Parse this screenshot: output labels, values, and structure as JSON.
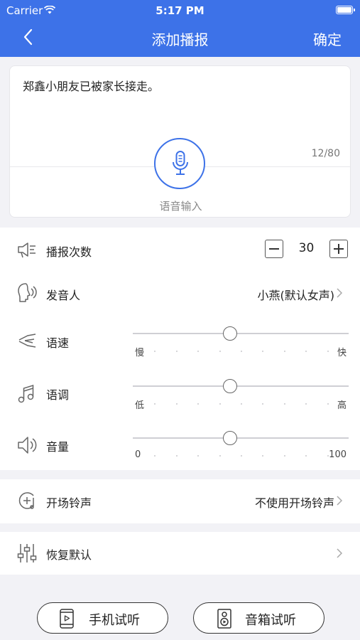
{
  "status": {
    "carrier": "Carrier",
    "time": "5:17 PM"
  },
  "nav": {
    "title": "添加播报",
    "confirm": "确定"
  },
  "text_input": {
    "content": "郑鑫小朋友已被家长接走。",
    "counter": "12/80",
    "voice_label": "语音输入"
  },
  "settings": {
    "play_count": {
      "label": "播报次数",
      "value": "30"
    },
    "speaker": {
      "label": "发音人",
      "value": "小燕(默认女声)"
    },
    "speed": {
      "label": "语速",
      "min_label": "慢",
      "max_label": "快",
      "level": 0.45
    },
    "pitch": {
      "label": "语调",
      "min_label": "低",
      "max_label": "高",
      "level": 0.45
    },
    "volume": {
      "label": "音量",
      "min_label": "0",
      "max_label": "100",
      "level": 0.45
    }
  },
  "opening_ring": {
    "label": "开场铃声",
    "value": "不使用开场铃声"
  },
  "restore": {
    "label": "恢复默认"
  },
  "actions": {
    "phone_preview": "手机试听",
    "speaker_preview": "音箱试听"
  },
  "colors": {
    "accent": "#3d72e8",
    "background": "#f2f2f6"
  }
}
